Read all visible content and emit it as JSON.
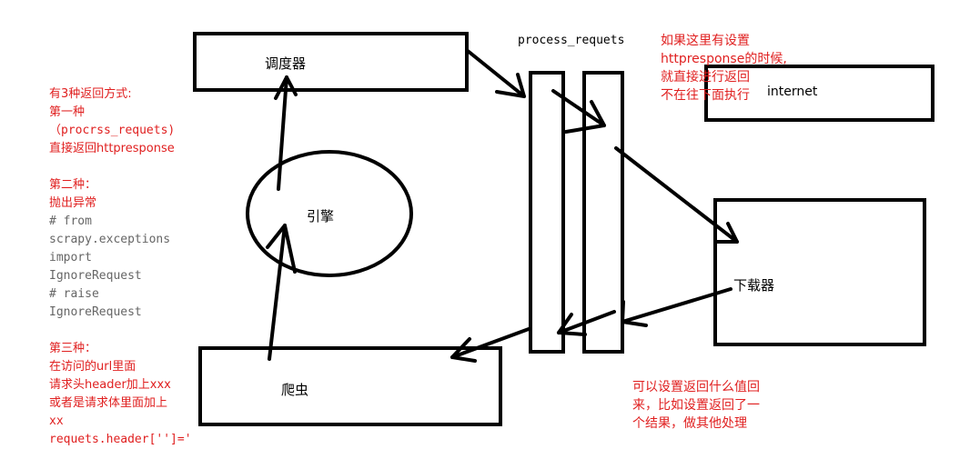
{
  "nodes": {
    "scheduler": "调度器",
    "engine": "引擎",
    "spider": "爬虫",
    "downloader": "下载器",
    "internet": "internet",
    "process_requests": "process_requets"
  },
  "note_top_right": {
    "lines": [
      "如果这里有设置",
      "httpresponse的时候,",
      "就直接进行返回",
      "不在往下面执行"
    ]
  },
  "note_bottom_right": {
    "lines": [
      "可以设置返回什么值回",
      "来，比如设置返回了一",
      "个结果，做其他处理"
    ]
  },
  "note_left": {
    "lines": [
      {
        "text": "有3种返回方式:",
        "color": "red"
      },
      {
        "text": "第一种",
        "color": "red"
      },
      {
        "text": "（procrss_requets)",
        "color": "red"
      },
      {
        "text": "直接返回httpresponse",
        "color": "red"
      },
      {
        "text": "",
        "color": "red"
      },
      {
        "text": "第二种：",
        "color": "red"
      },
      {
        "text": "抛出异常",
        "color": "red"
      },
      {
        "text": "# from",
        "color": "gray"
      },
      {
        "text": "scrapy.exceptions",
        "color": "gray"
      },
      {
        "text": "import",
        "color": "gray"
      },
      {
        "text": "IgnoreRequest",
        "color": "gray"
      },
      {
        "text": "# raise",
        "color": "gray"
      },
      {
        "text": "IgnoreRequest",
        "color": "gray"
      },
      {
        "text": "",
        "color": "red"
      },
      {
        "text": "第三种：",
        "color": "red"
      },
      {
        "text": "在访问的url里面",
        "color": "red"
      },
      {
        "text": "请求头header加上xxx",
        "color": "red"
      },
      {
        "text": "或者是请求体里面加上",
        "color": "red"
      },
      {
        "text": "xx",
        "color": "red"
      },
      {
        "text": "requets.header['']='",
        "color": "red"
      }
    ]
  }
}
